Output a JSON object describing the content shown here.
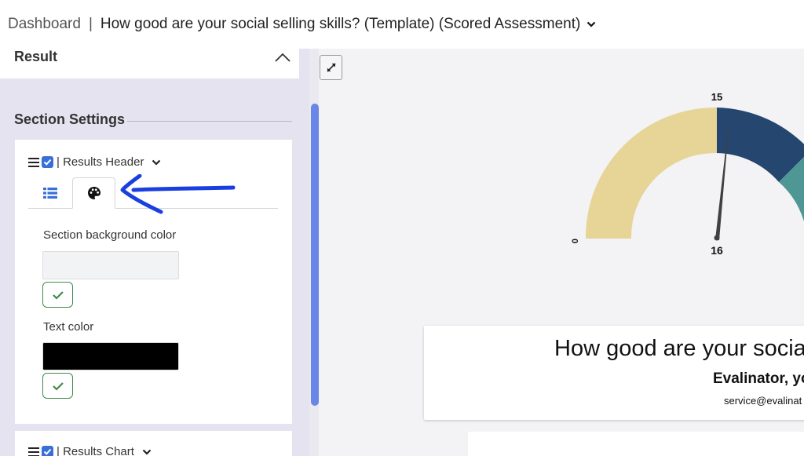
{
  "breadcrumb": {
    "dashboard": "Dashboard",
    "separator": "|",
    "title": "How good are your social selling skills? (Template) (Scored Assessment)"
  },
  "left_panel": {
    "result_title": "Result",
    "section_settings_title": "Section Settings",
    "results_header": {
      "label": "| Results Header",
      "checked": true,
      "tabs": [
        {
          "icon": "list-icon",
          "active": false
        },
        {
          "icon": "palette-icon",
          "active": true
        }
      ],
      "bg_color_label": "Section background color",
      "bg_color_value": "#f2f3f5",
      "text_color_label": "Text color",
      "text_color_value": "#000000"
    },
    "results_chart": {
      "label": "| Results Chart",
      "checked": true
    }
  },
  "gauge": {
    "min_label": "0",
    "top_label": "15",
    "value_label": "16",
    "colors": [
      "#e6d597",
      "#25466f",
      "#4f9795"
    ]
  },
  "preview_header": {
    "title": "How good are your socia",
    "subtitle": "Evalinator, yo",
    "email": "service@evalinat"
  },
  "colors": {
    "accent": "#3b6fd8",
    "confirm_green": "#3f8a4a",
    "annotation_arrow": "#1a3fe0"
  }
}
